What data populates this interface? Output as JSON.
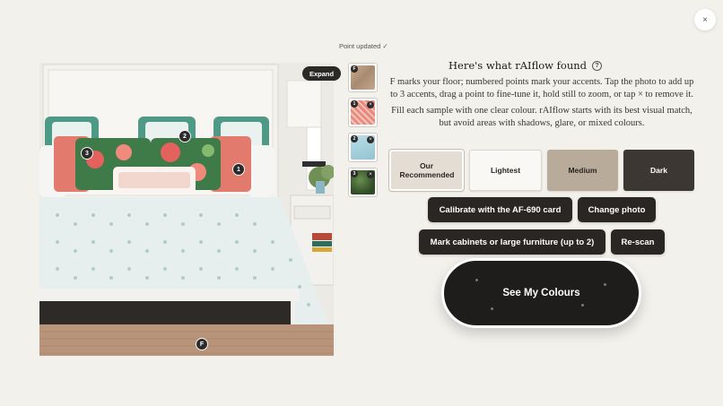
{
  "window": {
    "close_label": "×"
  },
  "status": {
    "point_updated": "Point updated ✓"
  },
  "photo": {
    "expand_label": "Expand",
    "markers": [
      {
        "label": "2"
      },
      {
        "label": "3"
      },
      {
        "label": "1"
      },
      {
        "label": "F"
      }
    ]
  },
  "thumbnails": [
    {
      "tag": "F",
      "remove": "",
      "color": "#b99a80"
    },
    {
      "tag": "1",
      "remove": "×",
      "color": "#e88a7e"
    },
    {
      "tag": "2",
      "remove": "×",
      "color": "#a9d3de"
    },
    {
      "tag": "3",
      "remove": "×",
      "color": "#3d5d32"
    }
  ],
  "panel": {
    "title": "Here's what rAIflow found",
    "help_label": "?",
    "instruction_1": "F marks your floor; numbered points mark your accents. Tap the photo to add up to 3 accents, drag a point to fine-tune it, hold still to zoom, or tap × to remove it.",
    "instruction_2": "Fill each sample with one clear colour. rAIflow starts with its best visual match, but avoid areas with shadows, glare, or mixed colours."
  },
  "levels": [
    {
      "label": "Our Recommended"
    },
    {
      "label": "Lightest"
    },
    {
      "label": "Medium"
    },
    {
      "label": "Dark"
    }
  ],
  "actions": {
    "calibrate": "Calibrate with the AF-690 card",
    "change_photo": "Change photo",
    "mark_furniture": "Mark cabinets or large furniture (up to 2)",
    "rescan": "Re-scan",
    "see_colours": "See My Colours"
  }
}
